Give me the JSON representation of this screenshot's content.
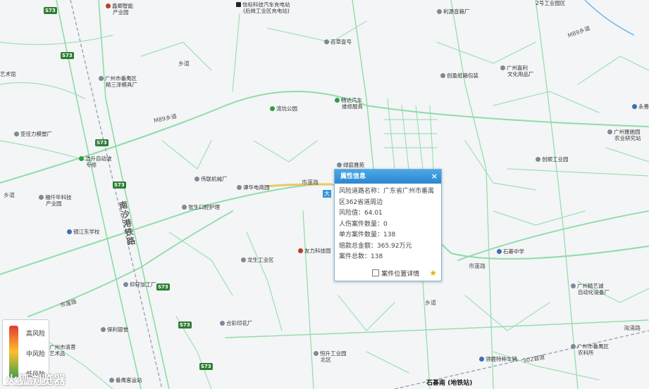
{
  "colors": {
    "road": "#7fd39a",
    "road_major": "#5cc07e",
    "rail": "#9aa6b2",
    "popup_header": "#3596d8"
  },
  "pois": [
    {
      "name": "鑫卿智能",
      "sub": "产业园",
      "icon": "red"
    },
    {
      "name": "信标科技汽车充电站",
      "sub": "(后岗工业区充电站)",
      "icon": "black"
    },
    {
      "name": "利源音箱厂",
      "sub": "",
      "icon": "gray"
    },
    {
      "name": "2号工业园区",
      "sub": "",
      "icon": "gray"
    },
    {
      "name": "百草壹号",
      "sub": "",
      "icon": "gray"
    },
    {
      "name": "艺术馆",
      "sub": "",
      "icon": "gray"
    },
    {
      "name": "广州市番禺区",
      "sub": "精三泽模具厂",
      "icon": "gray"
    },
    {
      "name": "创盈纸箱包装",
      "sub": "",
      "icon": "gray"
    },
    {
      "name": "广州嘉利",
      "sub": "文化用品厂",
      "icon": "gray"
    },
    {
      "name": "流坑公园",
      "sub": "",
      "icon": "green"
    },
    {
      "name": "畅达汽车",
      "sub": "维修服务",
      "icon": "green"
    },
    {
      "name": "永善",
      "sub": "",
      "icon": "blue"
    },
    {
      "name": "亚佳力模塑厂",
      "sub": "",
      "icon": "gray"
    },
    {
      "name": "广州雅驰园",
      "sub": "农业研究站",
      "icon": "gray"
    },
    {
      "name": "浩升自动波",
      "sub": "专修",
      "icon": "green"
    },
    {
      "name": "绿庭雅苑",
      "sub": "",
      "icon": "gray"
    },
    {
      "name": "创顺工业园",
      "sub": "",
      "icon": "gray"
    },
    {
      "name": "伟联机械厂",
      "sub": "",
      "icon": "gray"
    },
    {
      "name": "福仟年科技",
      "sub": "产业园",
      "icon": "gray"
    },
    {
      "name": "谭华电商园",
      "sub": "",
      "icon": "gray"
    },
    {
      "name": "张生口腔护理",
      "sub": "",
      "icon": "gray"
    },
    {
      "name": "镜江东学校",
      "sub": "",
      "icon": "blue"
    },
    {
      "name": "友力科技园",
      "sub": "",
      "icon": "gray"
    },
    {
      "name": "石碁中学",
      "sub": "",
      "icon": "blue"
    },
    {
      "name": "龙生工业区",
      "sub": "",
      "icon": "gray"
    },
    {
      "name": "仰轩加工厂",
      "sub": "",
      "icon": "gray"
    },
    {
      "name": "广州精艺诚",
      "sub": "自动化设备厂",
      "icon": "gray"
    },
    {
      "name": "合彩印花厂",
      "sub": "",
      "icon": "gray"
    },
    {
      "name": "保利银誉",
      "sub": "",
      "icon": "gray"
    },
    {
      "name": "广州市番禺区",
      "sub": "农科所",
      "icon": "gray"
    },
    {
      "name": "广州市清菩",
      "sub": "艺术品",
      "icon": "gray"
    },
    {
      "name": "恒升工业园",
      "sub": "北区",
      "icon": "gray"
    },
    {
      "name": "领鹿特种车辆",
      "sub": "",
      "icon": "blue"
    },
    {
      "name": "番禺客运站",
      "sub": "",
      "icon": "gray"
    }
  ],
  "roads": [
    {
      "label": "M89乡道"
    },
    {
      "label": "M89乡道"
    },
    {
      "label": "市蓬路"
    },
    {
      "label": "市蓬路"
    },
    {
      "label": "市蓬路"
    },
    {
      "label": "海涌路"
    },
    {
      "label": "302县道"
    },
    {
      "label": "乡道"
    },
    {
      "label": "乡道"
    },
    {
      "label": "乡道"
    },
    {
      "label": "大"
    }
  ],
  "highway_shields": [
    "S73",
    "S73",
    "S73",
    "S73",
    "S73",
    "S73",
    "S73"
  ],
  "rail": {
    "label": "南沙港铁路"
  },
  "station": {
    "label": "石碁南 (地铁站)"
  },
  "popup": {
    "title": "属性信息",
    "close": "×",
    "road_name_label": "风险道路名称：",
    "road_name_value": "广东省广州市番禺区362省道周边",
    "risk_label": "风险值：",
    "risk_value": "64.01",
    "injury_label": "人伤案件数量：",
    "injury_value": "0",
    "single_label": "单方案件数量：",
    "single_value": "138",
    "payout_label": "赔款总金额：",
    "payout_value": "365.92万元",
    "total_label": "案件总数：",
    "total_value": "138",
    "detail_label": "案件位置详情"
  },
  "legend": {
    "high": "高风险",
    "mid": "中风险",
    "low": "低风险"
  },
  "watermark": "火狐浏览器"
}
